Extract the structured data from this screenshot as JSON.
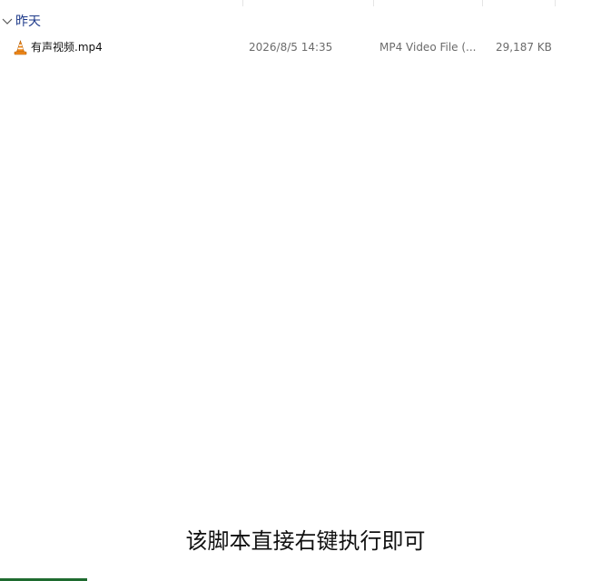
{
  "group": {
    "label": "昨天",
    "label_color": "#1e3a8a"
  },
  "files": [
    {
      "name": "有声视频.mp4",
      "date_modified": "2026/8/5 14:35",
      "type": "MP4 Video File (...",
      "size": "29,187 KB",
      "icon": "vlc-cone-icon"
    }
  ],
  "overlay_caption": "该脚本直接右键执行即可",
  "colors": {
    "taskbar_accent": "#1e6b2f",
    "icon_orange": "#f08a1c"
  }
}
